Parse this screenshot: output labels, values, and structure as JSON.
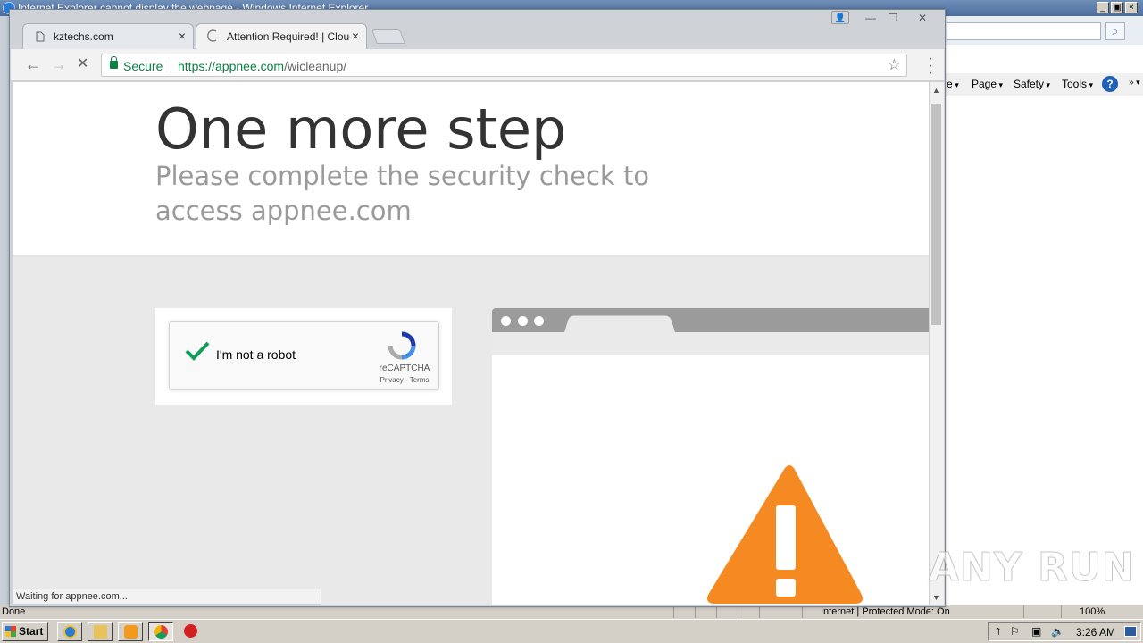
{
  "ie": {
    "title": "Internet Explorer cannot display the webpage - Windows Internet Explorer",
    "command_bar": {
      "page": "Page",
      "safety": "Safety",
      "tools": "Tools",
      "help": "?"
    },
    "status": {
      "left": "Done",
      "zone": "Internet | Protected Mode: On",
      "zoom": "100%"
    }
  },
  "chrome": {
    "tabs": [
      {
        "title": "kztechs.com",
        "icon": "page-icon"
      },
      {
        "title": "Attention Required! | Cloudflare",
        "icon": "loading-spinner-icon"
      }
    ],
    "omnibox": {
      "secure_label": "Secure",
      "url_host": "https://appnee.com",
      "url_path": "/wicleanup/"
    },
    "status_text": "Waiting for appnee.com..."
  },
  "page": {
    "heading": "One more step",
    "subheading": "Please complete the security check to access appnee.com",
    "captcha": {
      "label": "I'm not a robot",
      "brand": "reCAPTCHA",
      "links": "Privacy - Terms"
    }
  },
  "taskbar": {
    "start_label": "Start",
    "clock": "3:26 AM"
  },
  "watermark": "ANY RUN",
  "colors": {
    "secure_green": "#0b8043",
    "warning_orange": "#f48a21",
    "check_green": "#109d59"
  }
}
